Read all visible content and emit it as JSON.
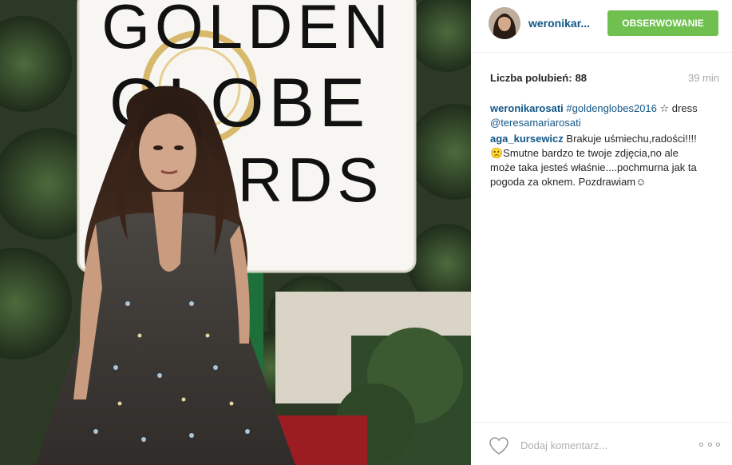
{
  "post": {
    "photo_sign_lines": [
      "GOLDEN",
      "GLOBE",
      "ARDS"
    ]
  },
  "header": {
    "username": "weronikar...",
    "follow_label": "OBSERWOWANIE",
    "follow_color": "#70c050"
  },
  "stats": {
    "likes_label": "Liczba polubień:",
    "likes_count": "88",
    "time": "39 min"
  },
  "comments": [
    {
      "user": "weronikarosati",
      "hashtag": "#goldenglobes2016",
      "star": "☆",
      "text_pre": "dress",
      "mention": "@teresamariarosati"
    },
    {
      "user": "aga_kursewicz",
      "text": "Brakuje uśmiechu,radości!!!!🙁Smutne bardzo te twoje zdjęcia,no ale może taka jesteś właśnie....pochmurna jak ta pogoda za oknem. Pozdrawiam☺"
    }
  ],
  "footer": {
    "comment_placeholder": "Dodaj komentarz...",
    "like_icon": "heart-icon",
    "more_icon": "more-options-icon"
  },
  "colors": {
    "link": "#125688",
    "muted": "#a5a7aa",
    "text": "#262626"
  }
}
